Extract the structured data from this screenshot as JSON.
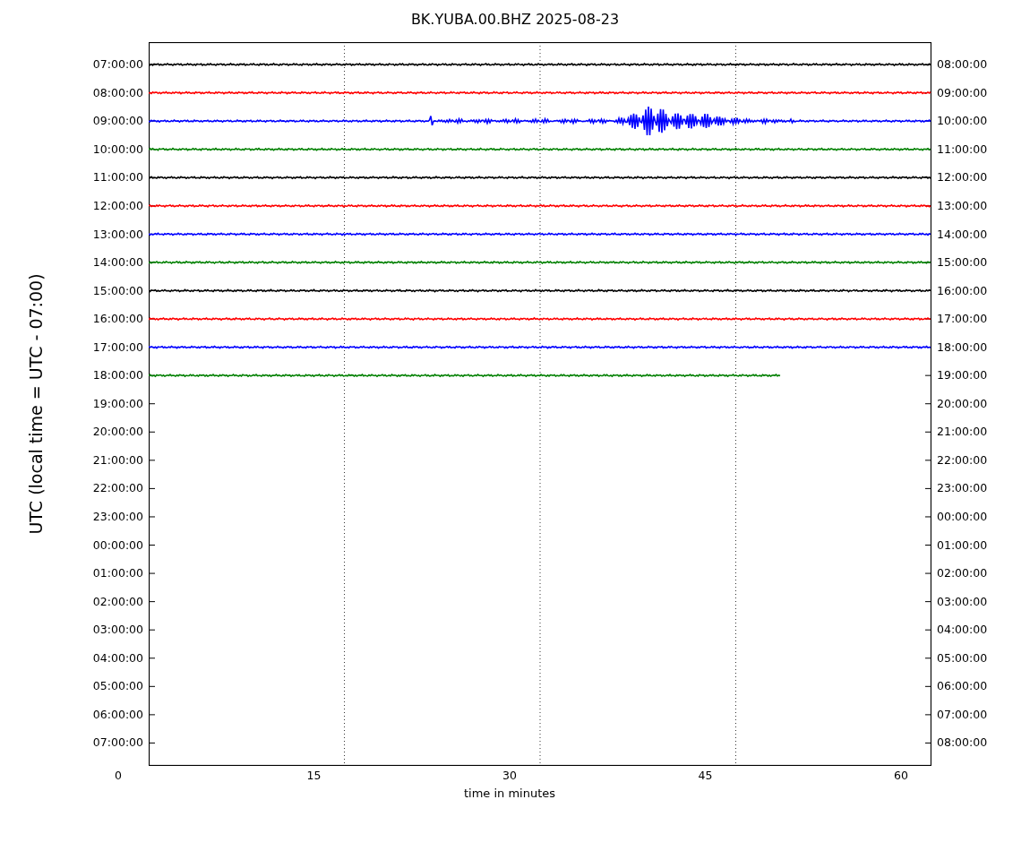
{
  "title": "BK.YUBA.00.BHZ 2025-08-23",
  "ylabel": "UTC (local time = UTC - 07:00)",
  "xlabel": "time in minutes",
  "xticks": [
    "0",
    "15",
    "30",
    "45",
    "60"
  ],
  "rows": [
    {
      "left": "07:00:00",
      "right": "08:00:00"
    },
    {
      "left": "08:00:00",
      "right": "09:00:00"
    },
    {
      "left": "09:00:00",
      "right": "10:00:00"
    },
    {
      "left": "10:00:00",
      "right": "11:00:00"
    },
    {
      "left": "11:00:00",
      "right": "12:00:00"
    },
    {
      "left": "12:00:00",
      "right": "13:00:00"
    },
    {
      "left": "13:00:00",
      "right": "14:00:00"
    },
    {
      "left": "14:00:00",
      "right": "15:00:00"
    },
    {
      "left": "15:00:00",
      "right": "16:00:00"
    },
    {
      "left": "16:00:00",
      "right": "17:00:00"
    },
    {
      "left": "17:00:00",
      "right": "18:00:00"
    },
    {
      "left": "18:00:00",
      "right": "19:00:00"
    },
    {
      "left": "19:00:00",
      "right": "20:00:00"
    },
    {
      "left": "20:00:00",
      "right": "21:00:00"
    },
    {
      "left": "21:00:00",
      "right": "22:00:00"
    },
    {
      "left": "22:00:00",
      "right": "23:00:00"
    },
    {
      "left": "23:00:00",
      "right": "00:00:00"
    },
    {
      "left": "00:00:00",
      "right": "01:00:00"
    },
    {
      "left": "01:00:00",
      "right": "02:00:00"
    },
    {
      "left": "02:00:00",
      "right": "03:00:00"
    },
    {
      "left": "03:00:00",
      "right": "04:00:00"
    },
    {
      "left": "04:00:00",
      "right": "05:00:00"
    },
    {
      "left": "05:00:00",
      "right": "06:00:00"
    },
    {
      "left": "06:00:00",
      "right": "07:00:00"
    },
    {
      "left": "07:00:00",
      "right": "08:00:00"
    }
  ],
  "traces": [
    {
      "color": "#000000",
      "kind": "quiet"
    },
    {
      "color": "#ff0000",
      "kind": "quiet"
    },
    {
      "color": "#0000ff",
      "kind": "event"
    },
    {
      "color": "#008000",
      "kind": "quiet"
    },
    {
      "color": "#000000",
      "kind": "quiet"
    },
    {
      "color": "#ff0000",
      "kind": "quiet"
    },
    {
      "color": "#0000ff",
      "kind": "quiet"
    },
    {
      "color": "#008000",
      "kind": "quiet"
    },
    {
      "color": "#000000",
      "kind": "quiet"
    },
    {
      "color": "#ff0000",
      "kind": "quiet"
    },
    {
      "color": "#0000ff",
      "kind": "quiet"
    },
    {
      "color": "#008000",
      "kind": "partial"
    }
  ]
}
